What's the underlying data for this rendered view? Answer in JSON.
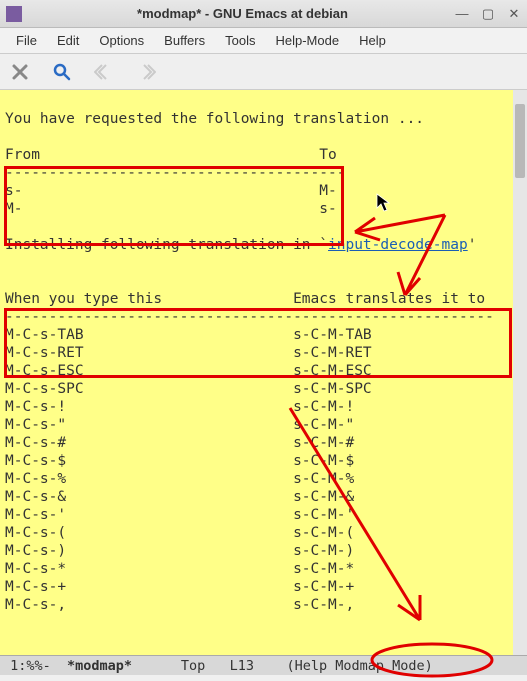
{
  "window": {
    "title": "*modmap* - GNU Emacs at debian"
  },
  "menubar": [
    "File",
    "Edit",
    "Options",
    "Buffers",
    "Tools",
    "Help-Mode",
    "Help"
  ],
  "content": {
    "intro": "You have requested the following translation ...",
    "blank": "",
    "table1_head": "From                                To",
    "table1_rule": "---------------------------------------",
    "table1_r1": "s-                                  M-",
    "table1_r2": "M-                                  s-",
    "install_pre": "Installing following translation in `",
    "install_link": "input-decode-map",
    "install_post": "'",
    "table2_head": "When you type this               Emacs translates it to",
    "table2_rule": "--------------------------------------------------------",
    "rows": [
      "M-C-s-TAB                        s-C-M-TAB",
      "M-C-s-RET                        s-C-M-RET",
      "M-C-s-ESC                        s-C-M-ESC",
      "M-C-s-SPC                        s-C-M-SPC",
      "M-C-s-!                          s-C-M-!",
      "M-C-s-\"                          s-C-M-\"",
      "M-C-s-#                          s-C-M-#",
      "M-C-s-$                          s-C-M-$",
      "M-C-s-%                          s-C-M-%",
      "M-C-s-&                          s-C-M-&",
      "M-C-s-'                          s-C-M-'",
      "M-C-s-(                          s-C-M-(",
      "M-C-s-)                          s-C-M-)",
      "M-C-s-*                          s-C-M-*",
      "M-C-s-+                          s-C-M-+",
      "M-C-s-,                          s-C-M-,"
    ]
  },
  "modeline": {
    "left": " 1:%%-  ",
    "buffer": "*modmap*",
    "mid": "      Top   L13    (Help Modmap Mode)"
  }
}
